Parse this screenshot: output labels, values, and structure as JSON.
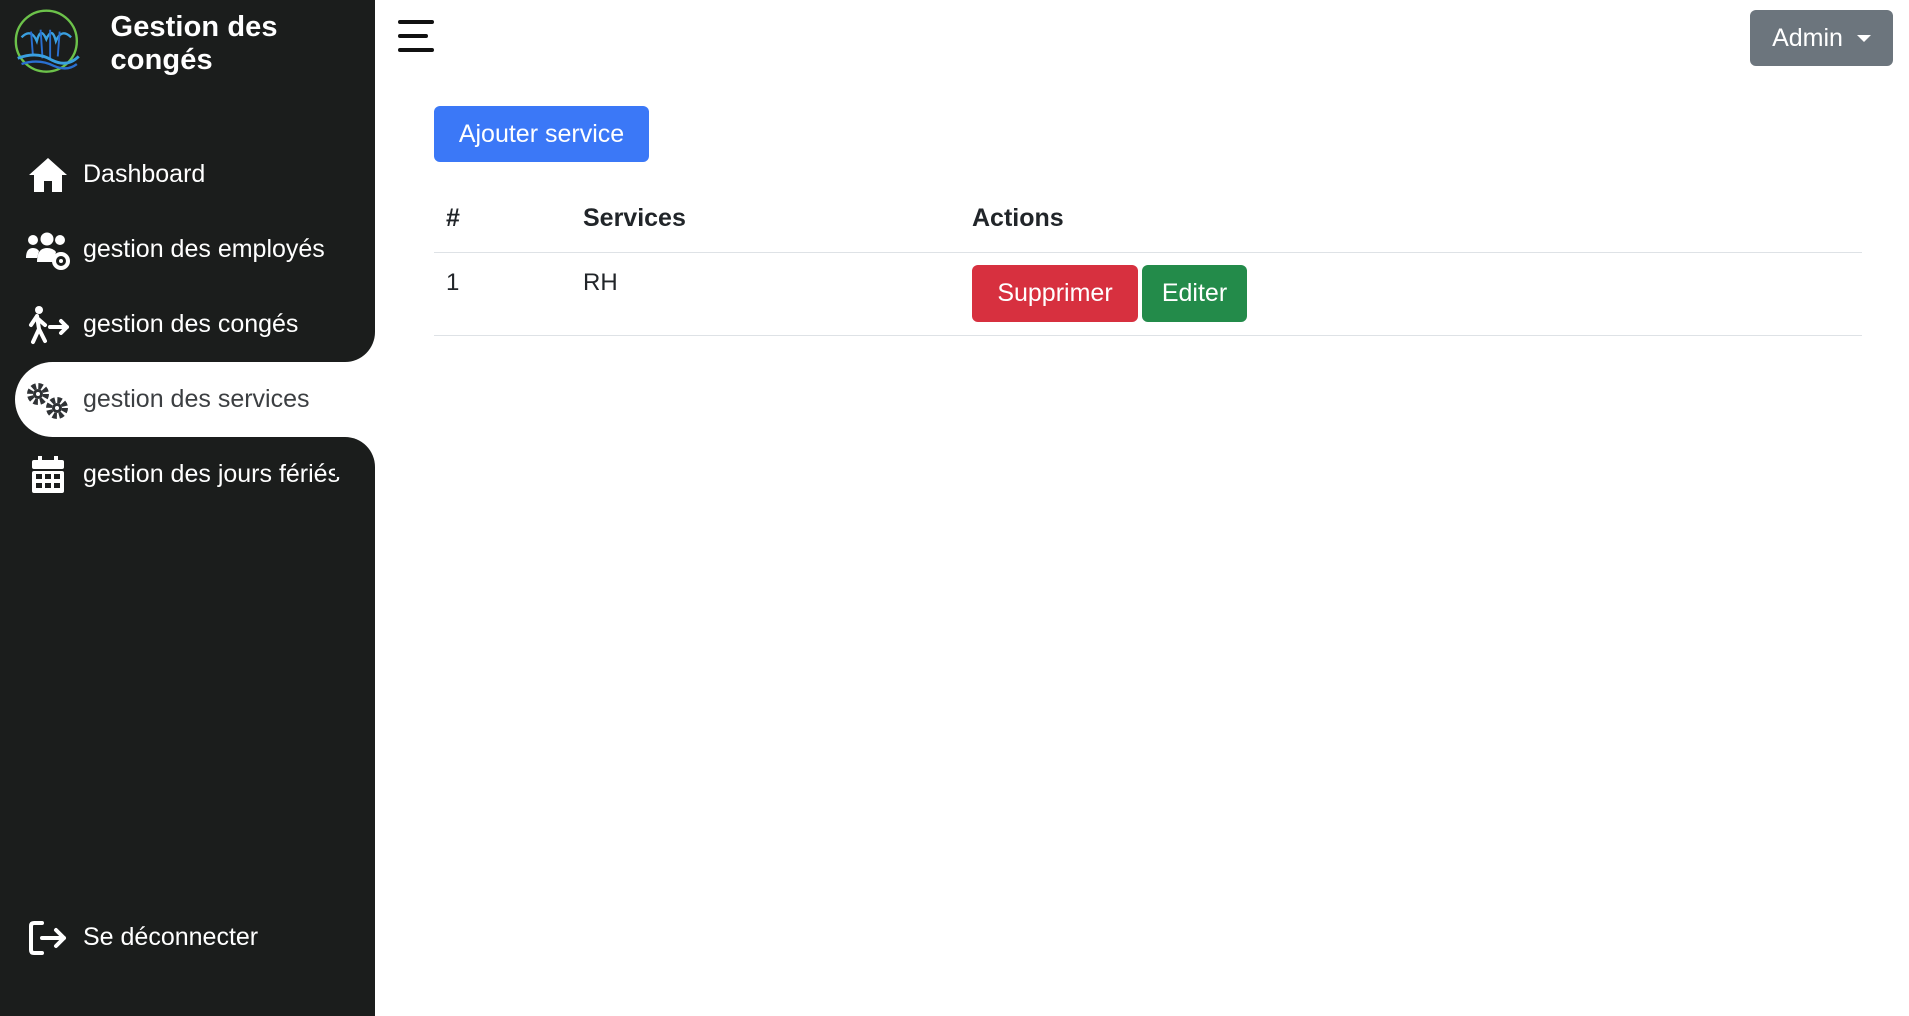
{
  "brand": {
    "title": "Gestion des congés",
    "logo_icon": "logo-icon"
  },
  "sidebar": {
    "items": [
      {
        "label": "Dashboard",
        "icon": "home-icon",
        "active": false
      },
      {
        "label": "gestion des employés",
        "icon": "users-gear-icon",
        "active": false
      },
      {
        "label": "gestion des congés",
        "icon": "person-walking-arrow-icon",
        "active": false
      },
      {
        "label": "gestion des services",
        "icon": "gears-icon",
        "active": true
      },
      {
        "label": "gestion des jours fériés",
        "icon": "calendar-icon",
        "active": false
      }
    ],
    "logout": {
      "label": "Se déconnecter",
      "icon": "sign-out-icon"
    }
  },
  "topbar": {
    "menu_icon": "hamburger-icon",
    "user_label": "Admin"
  },
  "main": {
    "add_button": "Ajouter service",
    "table": {
      "headers": [
        "#",
        "Services",
        "Actions"
      ],
      "rows": [
        {
          "id": "1",
          "service": "RH",
          "delete_label": "Supprimer",
          "edit_label": "Editer"
        }
      ]
    }
  },
  "colors": {
    "sidebar_bg": "#1b1d1c",
    "primary": "#3b78f7",
    "danger": "#d7303f",
    "success": "#238b4a",
    "secondary": "#6c757d"
  }
}
